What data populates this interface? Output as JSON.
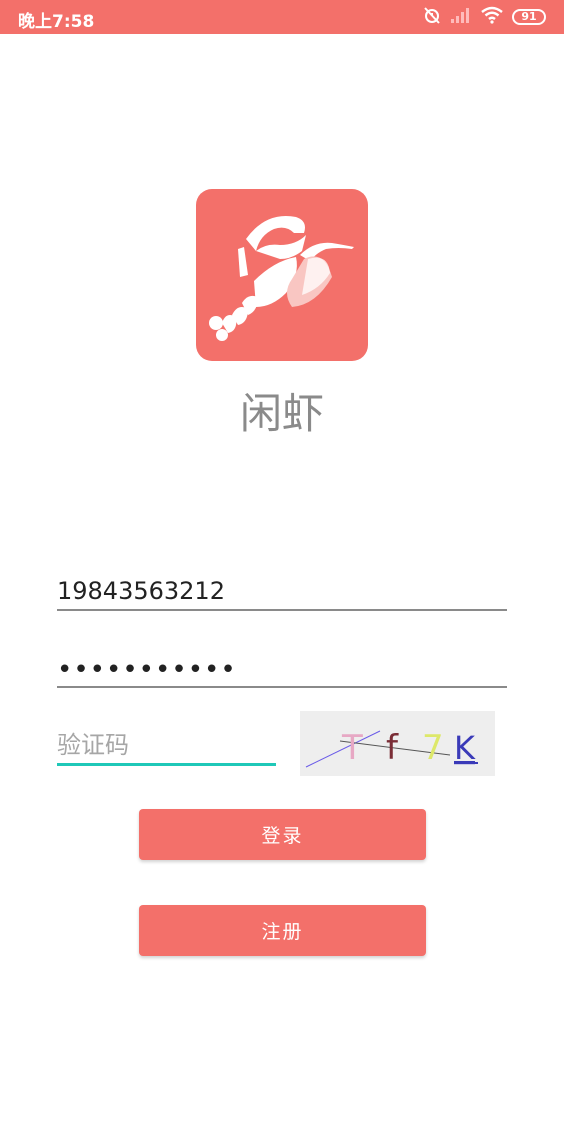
{
  "status_bar": {
    "time": "晚上7:58",
    "battery": "91",
    "color": "#f3706a"
  },
  "app": {
    "name": "闲虾",
    "logo_icon": "lobster-icon",
    "brand_color": "#f3706a"
  },
  "login_form": {
    "phone_value": "19843563212",
    "password_value": "•••••••••••",
    "captcha_placeholder": "验证码",
    "captcha_chars": [
      "T",
      "f",
      "7",
      "K"
    ],
    "captcha_colors": [
      "#e7a8c4",
      "#7a2d36",
      "#dde86a",
      "#3a3ab8"
    ],
    "login_label": "登录",
    "register_label": "注册",
    "focus_color": "#1fc8b8"
  }
}
